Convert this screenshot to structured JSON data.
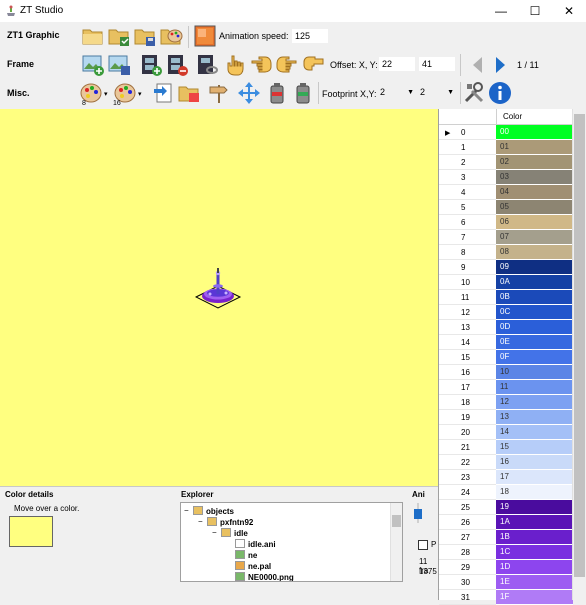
{
  "window": {
    "title": "ZT Studio",
    "minimize": "—",
    "maximize": "☐",
    "close": "✕"
  },
  "toolbar": {
    "row1_label": "ZT1 Graphic",
    "row2_label": "Frame",
    "row3_label": "Misc.",
    "animation_speed_label": "Animation speed:",
    "animation_speed_value": "125",
    "offset_label": "Offset: X, Y:",
    "offset_x": "22",
    "offset_y": "41",
    "frame_counter": "1 / 11",
    "footprint_label": "Footprint X,Y:",
    "footprint_x": "2",
    "footprint_y": "2",
    "palette8_num": "8",
    "palette16_num": "16"
  },
  "palette": {
    "header": "Color",
    "rows": [
      {
        "idx": "0",
        "code": "00",
        "color": "#00ff22"
      },
      {
        "idx": "1",
        "code": "01",
        "color": "#ab9a78"
      },
      {
        "idx": "2",
        "code": "02",
        "color": "#a29474"
      },
      {
        "idx": "3",
        "code": "03",
        "color": "#868276"
      },
      {
        "idx": "4",
        "code": "04",
        "color": "#a08f73"
      },
      {
        "idx": "5",
        "code": "05",
        "color": "#8d8572"
      },
      {
        "idx": "6",
        "code": "06",
        "color": "#d0b887"
      },
      {
        "idx": "7",
        "code": "07",
        "color": "#a49f8d"
      },
      {
        "idx": "8",
        "code": "08",
        "color": "#c4b28b"
      },
      {
        "idx": "9",
        "code": "09",
        "color": "#0f2f83"
      },
      {
        "idx": "10",
        "code": "0A",
        "color": "#1541a5"
      },
      {
        "idx": "11",
        "code": "0B",
        "color": "#1b4ab9"
      },
      {
        "idx": "12",
        "code": "0C",
        "color": "#2255cc"
      },
      {
        "idx": "13",
        "code": "0D",
        "color": "#2b5fd9"
      },
      {
        "idx": "14",
        "code": "0E",
        "color": "#3769e0"
      },
      {
        "idx": "15",
        "code": "0F",
        "color": "#4373e8"
      },
      {
        "idx": "16",
        "code": "10",
        "color": "#5b85e6"
      },
      {
        "idx": "17",
        "code": "11",
        "color": "#6b93ef"
      },
      {
        "idx": "18",
        "code": "12",
        "color": "#7da1f2"
      },
      {
        "idx": "19",
        "code": "13",
        "color": "#8fb0f4"
      },
      {
        "idx": "20",
        "code": "14",
        "color": "#a4c0f7"
      },
      {
        "idx": "21",
        "code": "15",
        "color": "#b6cdf9"
      },
      {
        "idx": "22",
        "code": "16",
        "color": "#c9daf9"
      },
      {
        "idx": "23",
        "code": "17",
        "color": "#dbe6fb"
      },
      {
        "idx": "24",
        "code": "18",
        "color": "#eef3fd"
      },
      {
        "idx": "25",
        "code": "19",
        "color": "#4a0c9e"
      },
      {
        "idx": "26",
        "code": "1A",
        "color": "#5a13b6"
      },
      {
        "idx": "27",
        "code": "1B",
        "color": "#6a1fcc"
      },
      {
        "idx": "28",
        "code": "1C",
        "color": "#7a2fe0"
      },
      {
        "idx": "29",
        "code": "1D",
        "color": "#8d45ee"
      },
      {
        "idx": "30",
        "code": "1E",
        "color": "#9d5df2"
      },
      {
        "idx": "31",
        "code": "1F",
        "color": "#b07bf6"
      }
    ]
  },
  "color_details": {
    "title": "Color details",
    "hint": "Move over a color.",
    "swatch_color": "#ffff80"
  },
  "explorer": {
    "title": "Explorer",
    "items": [
      {
        "label": "objects",
        "icon": "folder-open"
      },
      {
        "label": "pxfntn92",
        "icon": "folder-open"
      },
      {
        "label": "idle",
        "icon": "folder-open"
      },
      {
        "label": "idle.ani",
        "icon": "ani-file"
      },
      {
        "label": "ne",
        "icon": "image-file"
      },
      {
        "label": "ne.pal",
        "icon": "palette-file"
      },
      {
        "label": "NE0000.png",
        "icon": "image-file"
      }
    ]
  },
  "animation_panel": {
    "title": "Ani",
    "checkbox_label": "P",
    "info_line1": "11 fra",
    "info_line2": "1375"
  },
  "colors": {
    "canvas_bg": "#ffff80",
    "window_bg": "#f0f0f0"
  }
}
